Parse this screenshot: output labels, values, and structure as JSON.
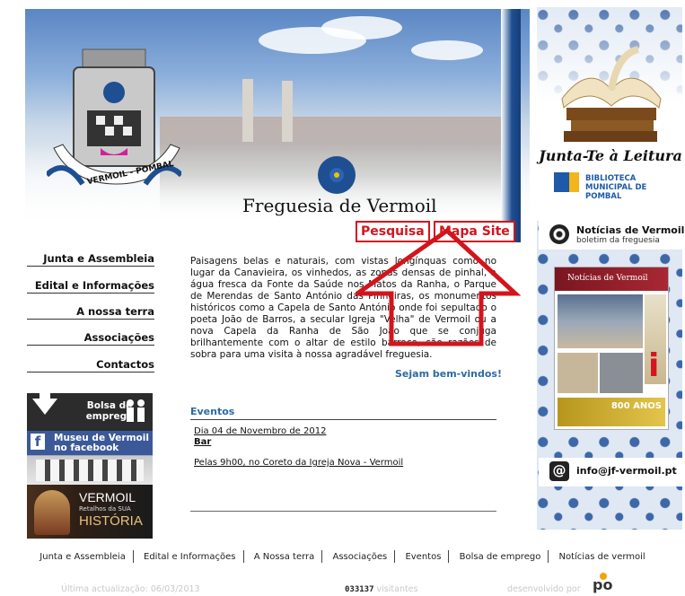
{
  "header": {
    "title": "Freguesia de Vermoil",
    "crest_ribbon": "VERMOIL - POMBAL"
  },
  "top_links": {
    "search": "Pesquisa",
    "sitemap": "Mapa Site"
  },
  "nav": {
    "items": [
      {
        "label": "Junta e Assembleia"
      },
      {
        "label": "Edital e Informações"
      },
      {
        "label": "A nossa terra"
      },
      {
        "label": "Associações"
      },
      {
        "label": "Contactos"
      }
    ]
  },
  "widgets": {
    "bolsa": "Bolsa de emprego",
    "facebook": "Museu de Vermoil no facebook",
    "historia_title": "VERMOIL",
    "historia_sub": "Retalhos da SUA",
    "historia_word": "HISTÓRIA"
  },
  "main": {
    "intro": "Paisagens belas e naturais, com vistas longínquas como no lugar da Canavieira, os vinhedos, as zonas densas de pinhal, a água fresca da Fonte da Saúde nos Matos da Ranha, o Parque de Merendas de Santo António das Pinheiras, os monumentos históricos como a Capela de Santo António onde foi sepultado o poeta João de Barros, a secular Igreja \"Velha\" de Vermoil ou a nova Capela da Ranha de São João que se conjuga brilhantemente com o altar de estilo barroco, são razões de sobra para uma visita à nossa agradável freguesia.",
    "welcome": "Sejam bem-vindos!"
  },
  "events": {
    "heading": "Eventos",
    "date": "Dia 04 de Novembro de 2012",
    "title": "Bar",
    "description": "Pelas 9h00, no Coreto da Igreja Nova - Vermoil"
  },
  "right": {
    "reading": "Junta-Te à Leitura",
    "library_l1": "BIBLIOTECA",
    "library_l2": "MUNICIPAL DE POMBAL",
    "news_title": "Notícias de Vermoil",
    "news_sub": "boletim da freguesia",
    "newsletter_masthead": "Notícias de Vermoil",
    "newsletter_banner": "800 ANOS",
    "email": "info@jf-vermoil.pt"
  },
  "footer": {
    "links": [
      "Junta e Assembleia",
      "Edital e Informações",
      "A Nossa terra",
      "Associações",
      "Eventos",
      "Bolsa de emprego",
      "Notícias de vermoil"
    ],
    "updated": "Última actualização: 06/03/2013",
    "counter": "033137",
    "counter_label": "visitantes",
    "developed": "desenvolvido por",
    "dev_logo": "po"
  },
  "colors": {
    "accent_red": "#d4141c",
    "link_blue": "#2b6aa8",
    "brand_blue": "#1e4f92"
  }
}
